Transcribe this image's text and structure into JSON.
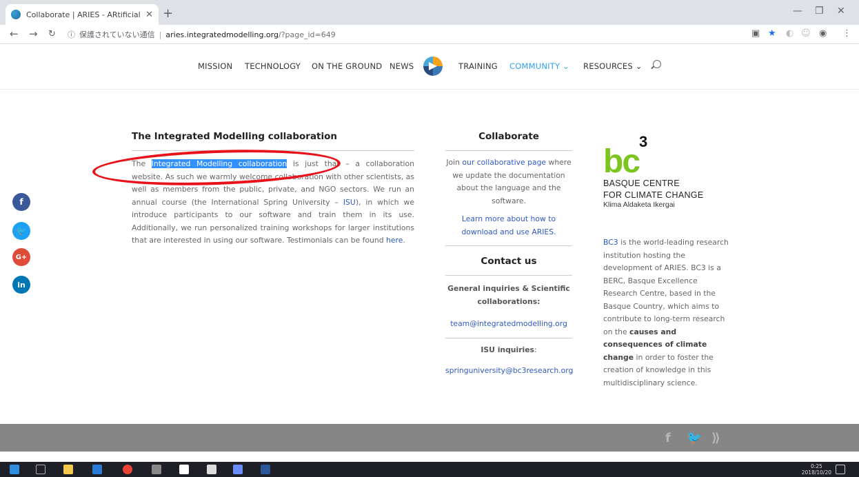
{
  "browser": {
    "tab_title": "Collaborate | ARIES - ARtificial In",
    "tab_close": "✕",
    "new_tab": "+",
    "security_text": "保護されていない通信",
    "url_host": "aries.integratedmodelling.org",
    "url_path": "/?page_id=649",
    "separator": "|"
  },
  "nav": {
    "items": [
      "MISSION",
      "TECHNOLOGY",
      "ON THE GROUND",
      "NEWS",
      "TRAINING",
      "COMMUNITY ⌄",
      "RESOURCES ⌄"
    ]
  },
  "main": {
    "title": "The Integrated Modelling collaboration",
    "p_pre": "The ",
    "p_highlight": "Integrated Modelling collaboration",
    "p_mid": " is just that – a collaboration website. As such we warmly welcome collaboration with other scientists, as well as members from the public, private, and NGO sectors. We run an annual course (the International Spring University – ",
    "isu_link": "ISU",
    "p_mid2": "), in which we introduce participants to our software and train them in its use. Additionally, we run personalized training workshops for larger institutions that are interested in using our software. Testimonials can be found ",
    "here_link": "here",
    "p_end": "."
  },
  "collab": {
    "title": "Collaborate",
    "p1_pre": "Join ",
    "p1_link": "our collaborative page",
    "p1_post": " where we update the documentation about the language and the software.",
    "learn_link": "Learn more about how to download and use ARIES.",
    "contact_title": "Contact us",
    "general_label": "General inquiries  & Scientific collaborations:",
    "general_email": "team@integratedmodelling.org",
    "isu_label": "ISU inquiries",
    "isu_colon": ":",
    "isu_email": "springuniversity@bc3research.org"
  },
  "bc3": {
    "logo_text": "bc",
    "logo_sup": "3",
    "name_line1": "BASQUE CENTRE",
    "name_line2": "FOR CLIMATE CHANGE",
    "sub": "Klima Aldaketa Ikergai",
    "p_link": "BC3",
    "p1": " is the world-leading research institution hosting the development of ARIES. BC3 is a BERC, Basque Excellence Research Centre, based in the Basque Country, which aims to contribute to long-term research on the ",
    "p_bold": "causes and consequences of climate change",
    "p2": " in order to foster the creation of knowledge in this multidisciplinary science."
  },
  "social": [
    "f",
    "t",
    "G+",
    "in"
  ],
  "footer": {
    "fb": "f",
    "tw": "🐦",
    "rss": "⟫"
  },
  "taskbar": {
    "time": "0:25",
    "date": "2018/10/20"
  },
  "colors": {
    "accent": "#2ea3f2",
    "link": "#2e59c4",
    "bc3_green": "#7cc520",
    "ellipse": "#e8131a"
  }
}
